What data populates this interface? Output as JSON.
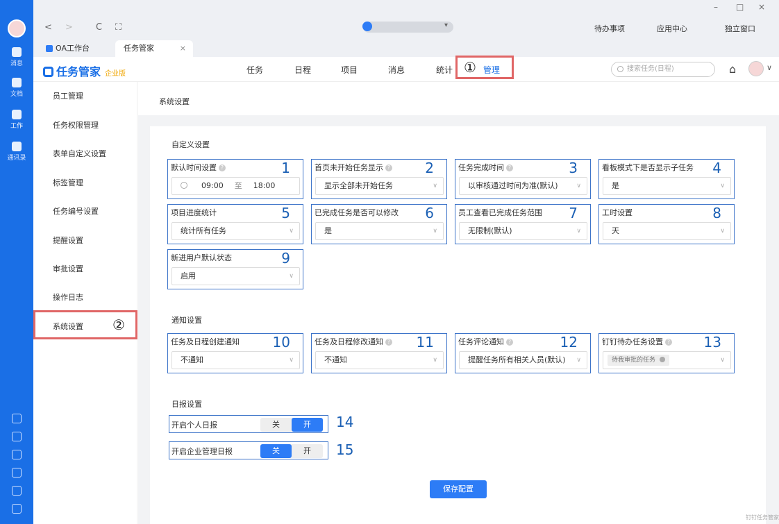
{
  "window": {
    "minimize": "–",
    "maximize": "□",
    "close": "×"
  },
  "nav": {
    "back": "<",
    "forward": ">",
    "refresh": "C",
    "fullscreen": "⛶",
    "addr_caret": "▾",
    "todo": "待办事项",
    "app_center": "应用中心",
    "standalone": "独立窗口"
  },
  "tabs": [
    {
      "label": "OA工作台"
    },
    {
      "label": "任务管家"
    }
  ],
  "tab_close": "×",
  "rail": {
    "items": [
      {
        "label": "消息"
      },
      {
        "label": "文档"
      },
      {
        "label": "工作"
      },
      {
        "label": "通讯录"
      }
    ]
  },
  "app": {
    "name": "任务管家",
    "edition": "企业版",
    "menu": [
      "任务",
      "日程",
      "项目",
      "消息",
      "统计",
      "管理"
    ],
    "search_placeholder": "搜索任务(日程)",
    "home_icon": "⌂",
    "caret": "∨"
  },
  "annotations": {
    "one": "①",
    "two": "②"
  },
  "sidebar": {
    "items": [
      "员工管理",
      "任务权限管理",
      "表单自定义设置",
      "标签管理",
      "任务编号设置",
      "提醒设置",
      "审批设置",
      "操作日志",
      "系统设置"
    ]
  },
  "breadcrumb": "系统设置",
  "custom": {
    "title": "自定义设置",
    "cards": [
      {
        "label": "默认时间设置",
        "num": "1",
        "help": true,
        "start": "09:00",
        "to": "至",
        "end": "18:00"
      },
      {
        "label": "首页未开始任务显示",
        "num": "2",
        "help": true,
        "value": "显示全部未开始任务"
      },
      {
        "label": "任务完成时间",
        "num": "3",
        "help": true,
        "value": "以审核通过时间为准(默认)"
      },
      {
        "label": "看板模式下是否显示子任务",
        "num": "4",
        "value": "是"
      },
      {
        "label": "项目进度统计",
        "num": "5",
        "value": "统计所有任务"
      },
      {
        "label": "已完成任务是否可以修改",
        "num": "6",
        "value": "是"
      },
      {
        "label": "员工查看已完成任务范围",
        "num": "7",
        "value": "无限制(默认)"
      },
      {
        "label": "工时设置",
        "num": "8",
        "value": "天"
      },
      {
        "label": "新进用户默认状态",
        "num": "9",
        "value": "启用"
      }
    ]
  },
  "notify": {
    "title": "通知设置",
    "cards": [
      {
        "label": "任务及日程创建通知",
        "num": "10",
        "value": "不通知"
      },
      {
        "label": "任务及日程修改通知",
        "num": "11",
        "help": true,
        "value": "不通知"
      },
      {
        "label": "任务评论通知",
        "num": "12",
        "help": true,
        "value": "提醒任务所有相关人员(默认)"
      },
      {
        "label": "钉钉待办任务设置",
        "num": "13",
        "help": true,
        "chip": "待我审批的任务"
      }
    ]
  },
  "daily": {
    "title": "日报设置",
    "items": [
      {
        "label": "开启个人日报",
        "off": "关",
        "on": "开",
        "selected": "on",
        "num": "14"
      },
      {
        "label": "开启企业管理日报",
        "off": "关",
        "on": "开",
        "selected": "off",
        "num": "15"
      }
    ]
  },
  "save_label": "保存配置",
  "help_mark": "?",
  "select_caret": "∨",
  "watermark": "钉钉任务管家"
}
